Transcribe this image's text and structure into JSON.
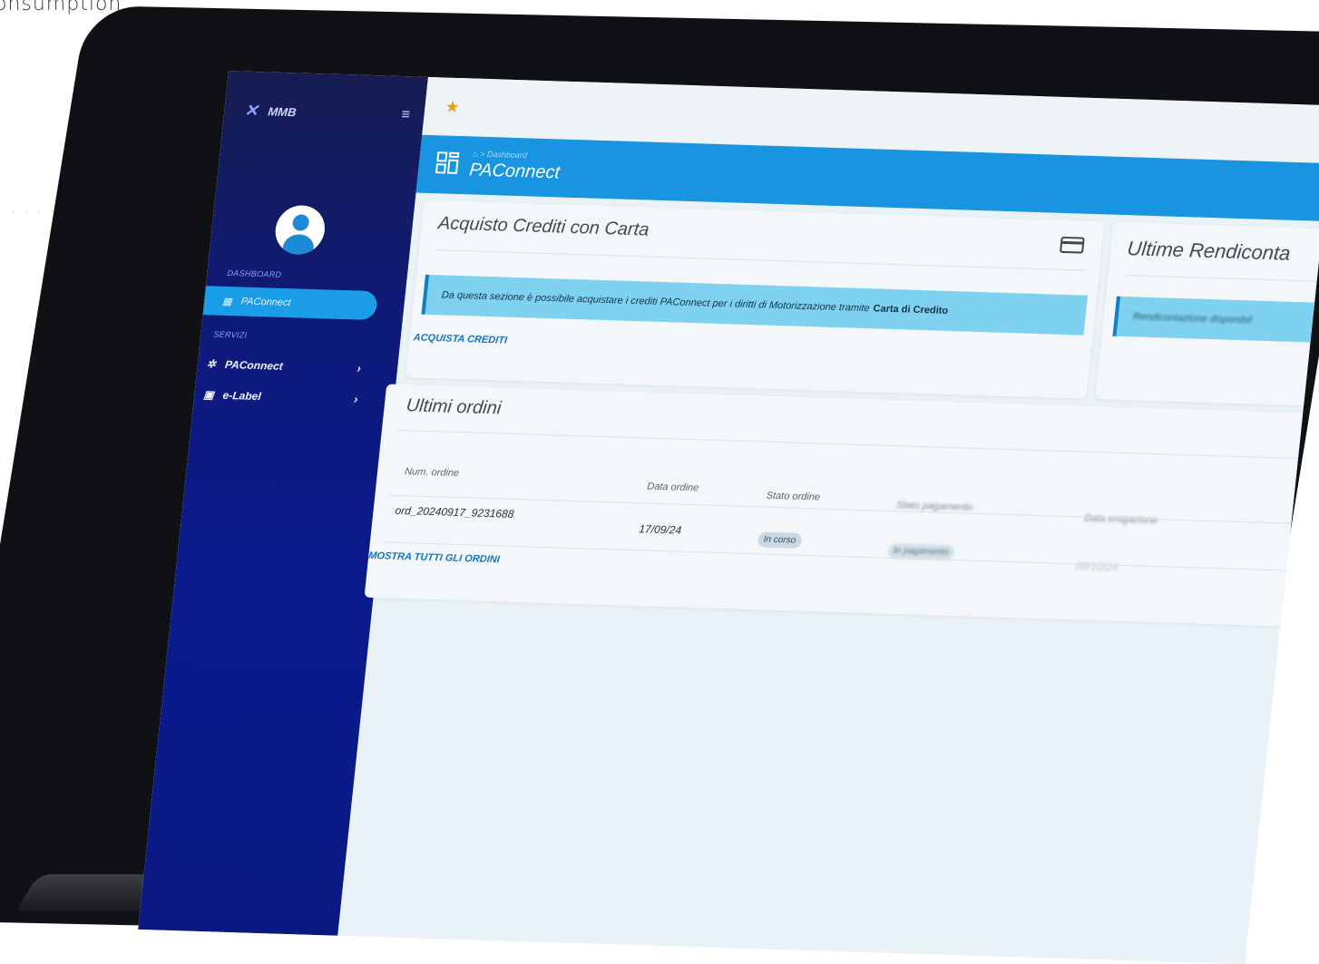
{
  "caption": "onsumption",
  "sidebar": {
    "brand": "MMB",
    "section_dashboard": "DASHBOARD",
    "active_item": "PAConnect",
    "section_services": "SERVIZI",
    "items": [
      {
        "label": "PAConnect"
      },
      {
        "label": "e-Label"
      }
    ]
  },
  "header": {
    "breadcrumb": "⌂ > Dashboard",
    "title": "PAConnect"
  },
  "purchase_card": {
    "title": "Acquisto Crediti con Carta",
    "info_text": "Da questa sezione è possibile acquistare i crediti PAConnect per i diritti di Motorizzazione tramite",
    "info_bold": "Carta di Credito",
    "action": "ACQUISTA CREDITI"
  },
  "reports_card": {
    "title": "Ultime Rendiconta",
    "info_text": "Rendicontazione disponibil"
  },
  "orders_card": {
    "title": "Ultimi ordini",
    "columns": [
      "Num. ordine",
      "Data ordine",
      "Stato ordine",
      "Stato pagamento",
      "Data erogazione"
    ],
    "rows": [
      {
        "num": "ord_20240917_9231688",
        "date": "17/09/24",
        "status": "In corso",
        "payment": "In pagamento",
        "delivery": "09/10/24"
      }
    ],
    "action": "MOSTRA TUTTI GLI ORDINI"
  }
}
